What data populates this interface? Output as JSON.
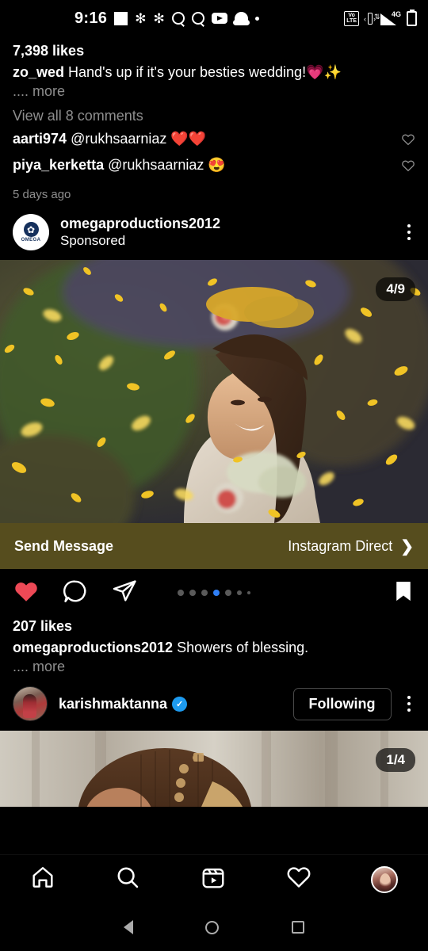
{
  "status_bar": {
    "time": "9:16",
    "left_icons": [
      "square-icon",
      "snowflake-icon",
      "snowflake-icon",
      "search-icon",
      "search-icon",
      "youtube-icon",
      "snapchat-icon",
      "dot-icon"
    ],
    "right_icons": [
      "volte-icon",
      "vibrate-icon",
      "signal-4g-icon",
      "battery-icon"
    ],
    "volte_line1": "Vo",
    "volte_line2": "LTE",
    "network": "4G"
  },
  "post_previous": {
    "likes": "7,398 likes",
    "caption_username": "zo_wed",
    "caption_text": "Hand's up if it's your besties wedding!💗✨",
    "more_label": ".... more",
    "view_comments": "View all 8 comments",
    "comments": [
      {
        "username": "aarti974",
        "text": "@rukhsaarniaz ❤️❤️"
      },
      {
        "username": "piya_kerketta",
        "text": "@rukhsaarniaz 😍"
      }
    ],
    "timestamp": "5 days ago"
  },
  "post_sponsored": {
    "username": "omegaproductions2012",
    "sponsored_label": "Sponsored",
    "avatar_brand": "OMEGA",
    "carousel_counter": "4/9",
    "cta_left": "Send Message",
    "cta_right": "Instagram Direct",
    "cta_color": "#564D1E",
    "likes": "207 likes",
    "caption_username": "omegaproductions2012",
    "caption_text": "Showers of blessing.",
    "more_label": ".... more",
    "liked": true,
    "like_color": "#ED4956",
    "dot_active_index": 3,
    "dot_active_color": "#2f7ff5",
    "dot_count": 7,
    "actions": [
      "like-icon",
      "comment-icon",
      "share-icon",
      "save-icon"
    ]
  },
  "post_next": {
    "username": "karishmaktanna",
    "verified": true,
    "verified_color": "#1d9bf0",
    "follow_label": "Following",
    "carousel_counter": "1/4"
  },
  "tab_bar": {
    "items": [
      "home-icon",
      "search-icon",
      "reels-icon",
      "activity-icon",
      "profile-avatar"
    ]
  },
  "system_nav": {
    "items": [
      "back-button",
      "home-button",
      "recents-button"
    ]
  }
}
